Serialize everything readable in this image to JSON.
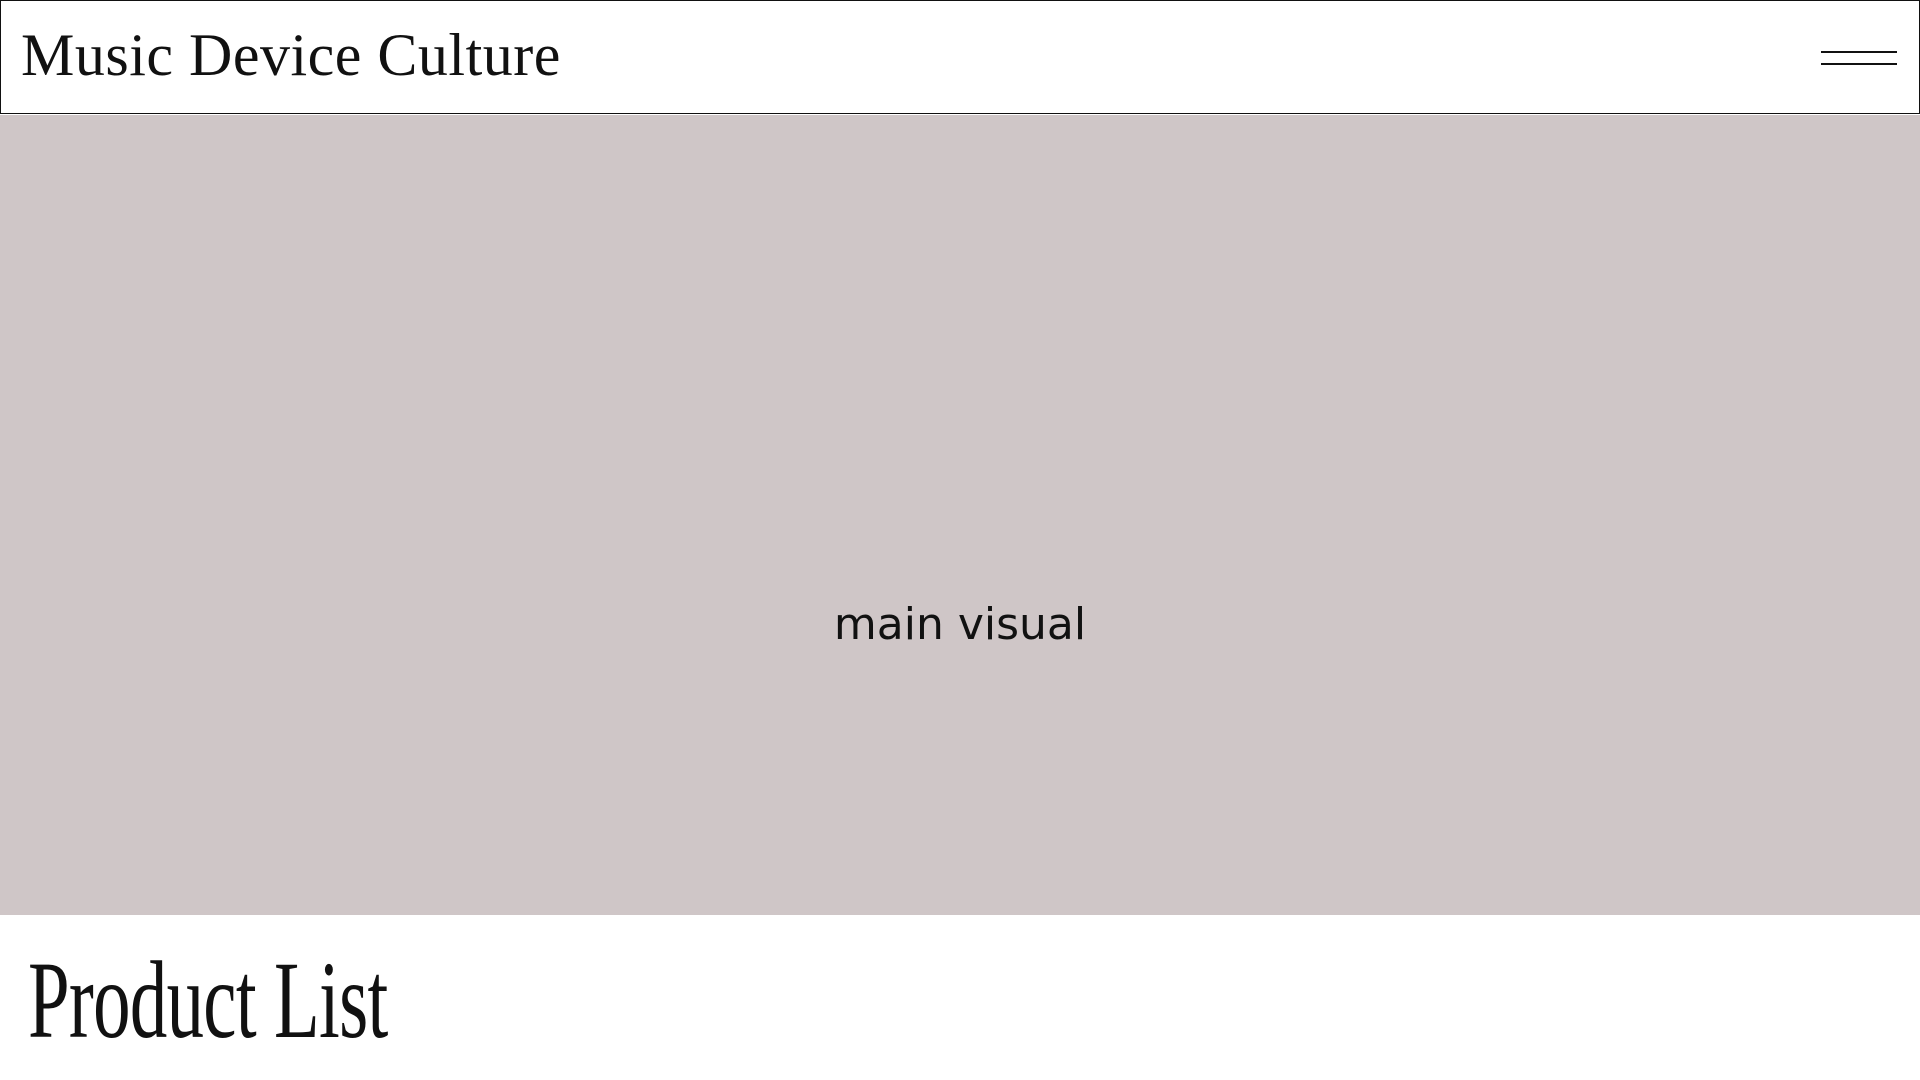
{
  "header": {
    "site_title": "Music Device Culture",
    "menu_icon": "hamburger-menu-icon"
  },
  "hero": {
    "label": "main visual",
    "background_color": "#cfc6c7"
  },
  "products": {
    "section_title": "Product List"
  }
}
